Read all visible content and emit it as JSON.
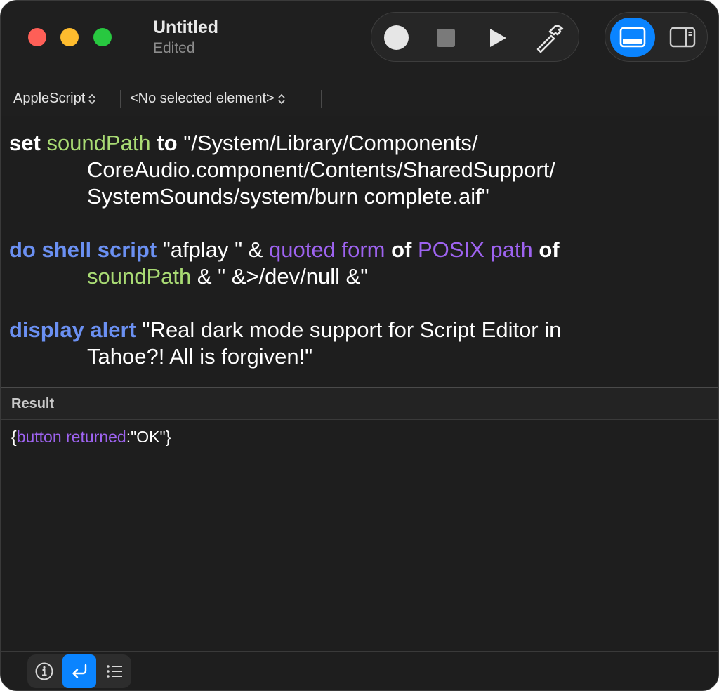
{
  "window": {
    "title": "Untitled",
    "subtitle": "Edited"
  },
  "toolbar": {
    "record_icon": "record-icon",
    "stop_icon": "stop-icon",
    "run_icon": "play-icon",
    "compile_icon": "hammer-icon",
    "view_bottom_icon": "bottom-panel-icon",
    "view_side_icon": "side-panel-icon"
  },
  "navbar": {
    "language": "AppleScript",
    "element": "<No selected element>"
  },
  "code": {
    "l1_set": "set",
    "l1_var": "soundPath",
    "l1_to": "to",
    "l1_str": "\"/System/Library/Components/",
    "l2_str": "CoreAudio.component/Contents/SharedSupport/",
    "l3_str": "SystemSounds/system/burn complete.aif\"",
    "l4_cmd": "do shell script",
    "l4_str": "\"afplay \" & ",
    "l4_prop1": "quoted form",
    "l4_of1": "of",
    "l4_prop2": "POSIX path",
    "l4_of2": "of",
    "l5_var": "soundPath",
    "l5_rest": " & \" &>/dev/null &\"",
    "l6_cmd": "display alert",
    "l6_str": "\"Real dark mode support for Script Editor in",
    "l7_str": "Tahoe?! All is forgiven!\""
  },
  "result": {
    "label": "Result",
    "open": "{",
    "key": "button returned",
    "value": ":\"OK\"}"
  },
  "bottom": {
    "info_icon": "info-icon",
    "return_icon": "return-arrow-icon",
    "list_icon": "list-icon"
  },
  "colors": {
    "accent": "#0a84ff",
    "keyword_command": "#6b90f2",
    "variable": "#a9db74",
    "property": "#9e63f0"
  }
}
